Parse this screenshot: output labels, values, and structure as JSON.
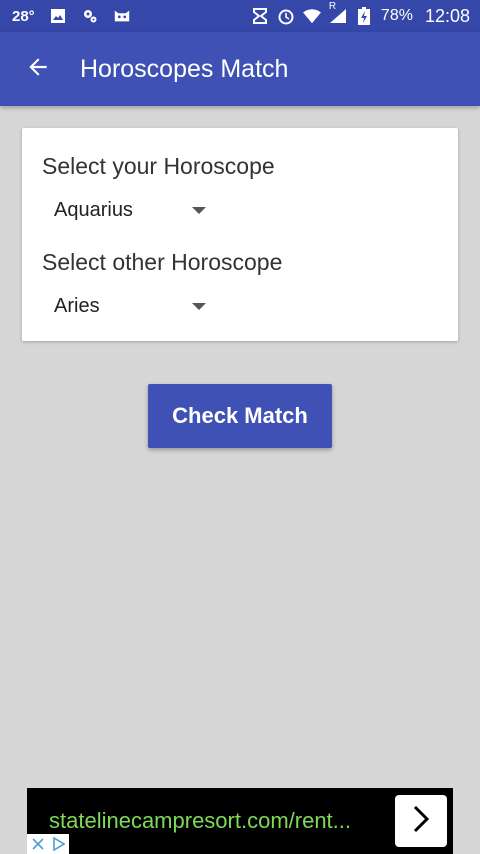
{
  "status_bar": {
    "temperature": "28°",
    "battery_percent": "78%",
    "time": "12:08",
    "icons": [
      "image-icon",
      "settings-gear-icon",
      "cat-icon",
      "hourglass-icon",
      "alarm-icon",
      "wifi-icon",
      "signal-icon",
      "battery-charging-icon"
    ],
    "signal_label": "R"
  },
  "app_bar": {
    "title": "Horoscopes Match",
    "back_icon": "arrow-back-icon",
    "background": "#3f51b5"
  },
  "form": {
    "label_1": "Select your Horoscope",
    "value_1": "Aquarius",
    "label_2": "Select other Horoscope",
    "value_2": "Aries"
  },
  "button": {
    "label": "Check Match",
    "color": "#3f51b5"
  },
  "ad": {
    "text": "statelinecampresort.com/rent...",
    "text_color": "#7ed957",
    "arrow_icon": "chevron-right-icon"
  }
}
